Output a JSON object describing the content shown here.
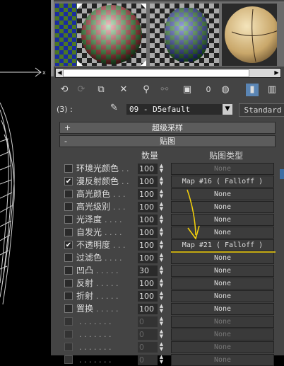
{
  "viewport": {
    "cursor_label": "x"
  },
  "slots": [
    {
      "name": "slot-1",
      "style": "checker"
    },
    {
      "name": "slot-2",
      "style": "checker-sphere"
    },
    {
      "name": "slot-3",
      "style": "checker-sphere-gray"
    },
    {
      "name": "slot-4",
      "style": "tan-sphere"
    }
  ],
  "toolbar": {
    "icons": [
      "get-material-icon",
      "put-to-scene-icon",
      "assign-material-icon",
      "reset-icon",
      "make-unique-icon",
      "put-to-library-icon",
      "material-id-icon",
      "show-map-icon",
      "show-end-result-icon",
      "go-to-parent-icon"
    ],
    "material_id_label": "0"
  },
  "material": {
    "slot_label": "(3) :",
    "name": "09 - D5efault",
    "type": "Standard"
  },
  "rollouts": {
    "supersampling": {
      "sign": "+",
      "title": "超级采样"
    },
    "maps": {
      "sign": "-",
      "title": "贴图"
    }
  },
  "maps_header": {
    "amount": "数量",
    "map_type": "贴图类型"
  },
  "map_rows": [
    {
      "label": "环境光颜色",
      "dots": ". .",
      "checked": false,
      "amount": "100",
      "map": "None",
      "enabled": true,
      "mapDim": true
    },
    {
      "label": "漫反射颜色",
      "dots": ". .",
      "checked": true,
      "amount": "100",
      "map": "Map #16  ( Falloff )",
      "enabled": true
    },
    {
      "label": "高光颜色",
      "dots": ". . .",
      "checked": false,
      "amount": "100",
      "map": "None",
      "enabled": true
    },
    {
      "label": "高光级别",
      "dots": ". . .",
      "checked": false,
      "amount": "100",
      "map": "None",
      "enabled": true
    },
    {
      "label": "光泽度",
      "dots": ". . . .",
      "checked": false,
      "amount": "100",
      "map": "None",
      "enabled": true
    },
    {
      "label": "自发光",
      "dots": ". . . .",
      "checked": false,
      "amount": "100",
      "map": "None",
      "enabled": true
    },
    {
      "label": "不透明度",
      "dots": ". . .",
      "checked": true,
      "amount": "100",
      "map": "Map #21  ( Falloff )",
      "enabled": true
    },
    {
      "label": "过滤色",
      "dots": ". . . .",
      "checked": false,
      "amount": "100",
      "map": "None",
      "enabled": true
    },
    {
      "label": "凹凸",
      "dots": ". . . . .",
      "checked": false,
      "amount": "30",
      "map": "None",
      "enabled": true
    },
    {
      "label": "反射",
      "dots": ". . . . .",
      "checked": false,
      "amount": "100",
      "map": "None",
      "enabled": true
    },
    {
      "label": "折射",
      "dots": ". . . . .",
      "checked": false,
      "amount": "100",
      "map": "None",
      "enabled": true
    },
    {
      "label": "置换",
      "dots": ". . . . .",
      "checked": false,
      "amount": "100",
      "map": "None",
      "enabled": true
    },
    {
      "label": "",
      "dots": ". . . . . . .",
      "checked": false,
      "amount": "0",
      "map": "None",
      "enabled": false
    },
    {
      "label": "",
      "dots": ". . . . . . .",
      "checked": false,
      "amount": "0",
      "map": "None",
      "enabled": false
    },
    {
      "label": "",
      "dots": ". . . . . . .",
      "checked": false,
      "amount": "0",
      "map": "None",
      "enabled": false
    },
    {
      "label": "",
      "dots": ". . . . . . .",
      "checked": false,
      "amount": "0",
      "map": "None",
      "enabled": false
    }
  ],
  "colors": {
    "panel_bg": "#444444",
    "annotation": "#f5d20a",
    "active_tool": "#5a85b4"
  }
}
